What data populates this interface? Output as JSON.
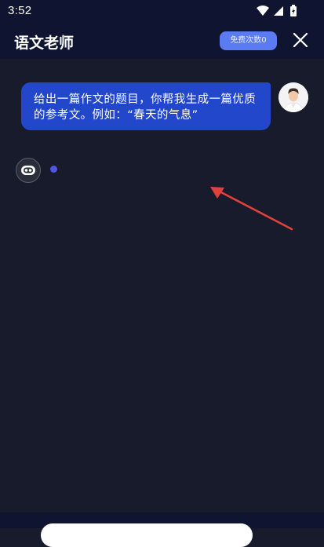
{
  "status_bar": {
    "time": "3:52",
    "icons": [
      "wifi-icon",
      "cellular-signal-icon",
      "battery-charging-icon"
    ]
  },
  "header": {
    "title": "语文老师",
    "quota_badge": "免费次数0",
    "close_icon": "close-icon"
  },
  "chat": {
    "messages": [
      {
        "sender": "user",
        "text": "给出一篇作文的题目，你帮我生成一篇优质的参考文。例如：“春天的气息”"
      }
    ],
    "bot_avatar_icon": "robot-face-icon",
    "typing_indicator": true
  },
  "colors": {
    "background": "#171b2c",
    "header": "#0f1530",
    "user_bubble": "#2347cb",
    "quota_badge": "#5b7bf2",
    "typing_dot": "#4f55e8",
    "annotation_arrow": "#e0413a"
  }
}
